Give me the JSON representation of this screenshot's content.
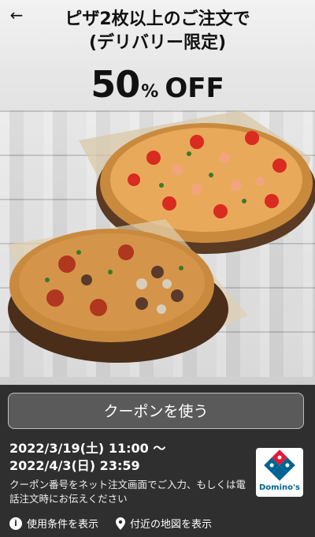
{
  "header": {
    "back_icon": "arrow-left-icon",
    "title_line1": "ピザ2枚以上のご注文で",
    "title_line2": "(デリバリー限定)"
  },
  "discount": {
    "amount": "50",
    "percent": "%",
    "off": "OFF"
  },
  "coupon": {
    "button_label": "クーポンを使う",
    "date_start": "2022/3/19(土) 11:00 〜",
    "date_end": "2022/4/3(日) 23:59",
    "note": "クーポン番号をネット注文画面でご入力、もしくは電話注文時にお伝えください"
  },
  "brand": {
    "name": "Domino's",
    "colors": {
      "blue": "#006491",
      "red": "#e31837"
    }
  },
  "links": {
    "terms": "使用条件を表示",
    "terms_icon": "info-icon",
    "map": "付近の地図を表示",
    "map_icon": "map-pin-icon"
  }
}
